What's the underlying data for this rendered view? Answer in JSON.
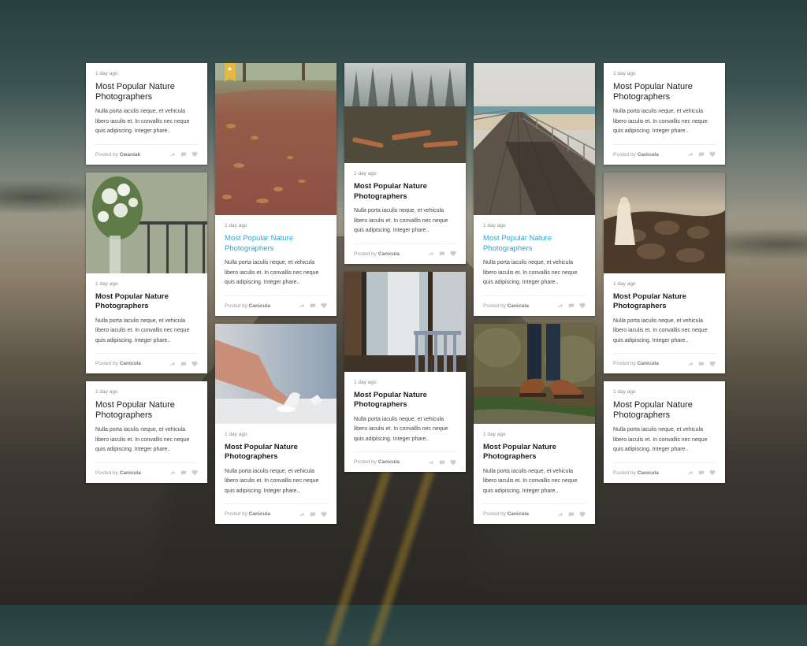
{
  "time_label": "1 day ago",
  "title": "Most Popular Nature Photographers",
  "excerpt_long": "Nulla porta iaculis neque, et vehicula libero iaculis et. In convallis nec neque quis adipiscing. Integer phare..",
  "excerpt_short": "Nulla porta iaculis neque, et vehicula libero iaculis et. In convallis nec neque quis adipiscing. Integer phare..",
  "posted_prefix": "Posted by",
  "authors": {
    "cwaniak": "Cwaniak",
    "canicula": "Canicula"
  },
  "colors": {
    "accent": "#2ea3d6",
    "bookmark": "#e8b73d"
  },
  "icons": [
    "share-icon",
    "comment-icon",
    "heart-icon",
    "star-icon"
  ],
  "images": [
    "autumn-leaves-path",
    "foggy-forest-logs",
    "wooden-pier",
    "monk-on-rocks",
    "window-plants",
    "finger-on-chess-piece",
    "porch-window-chair",
    "hiking-boots"
  ]
}
